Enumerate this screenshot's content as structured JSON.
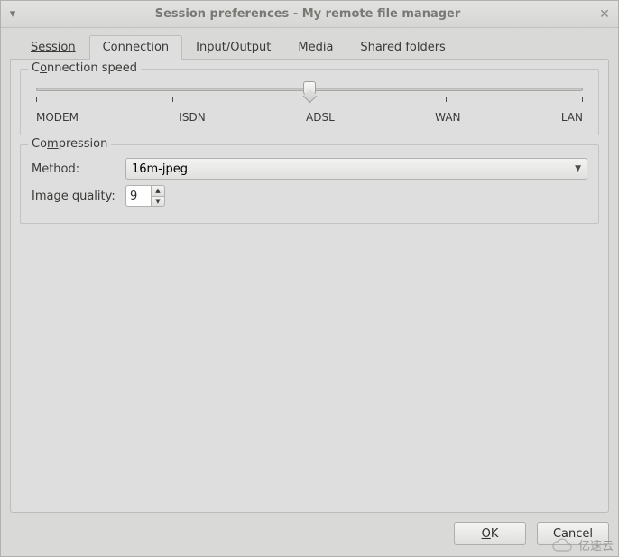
{
  "window": {
    "title": "Session preferences - My remote file manager"
  },
  "tabs": {
    "session": "Session",
    "connection": "Connection",
    "io": "Input/Output",
    "media": "Media",
    "shared": "Shared folders"
  },
  "speed": {
    "group_label_pre": "C",
    "group_label_u": "o",
    "group_label_post": "nnection speed",
    "labels": [
      "MODEM",
      "ISDN",
      "ADSL",
      "WAN",
      "LAN"
    ],
    "value_index": 2
  },
  "compression": {
    "group_label_pre": "Co",
    "group_label_u": "m",
    "group_label_post": "pression",
    "method_label": "Method:",
    "method_value": "16m-jpeg",
    "quality_label": "Image quality:",
    "quality_value": "9"
  },
  "buttons": {
    "ok_u": "O",
    "ok_rest": "K",
    "cancel": "Cancel"
  },
  "watermark": "亿速云"
}
